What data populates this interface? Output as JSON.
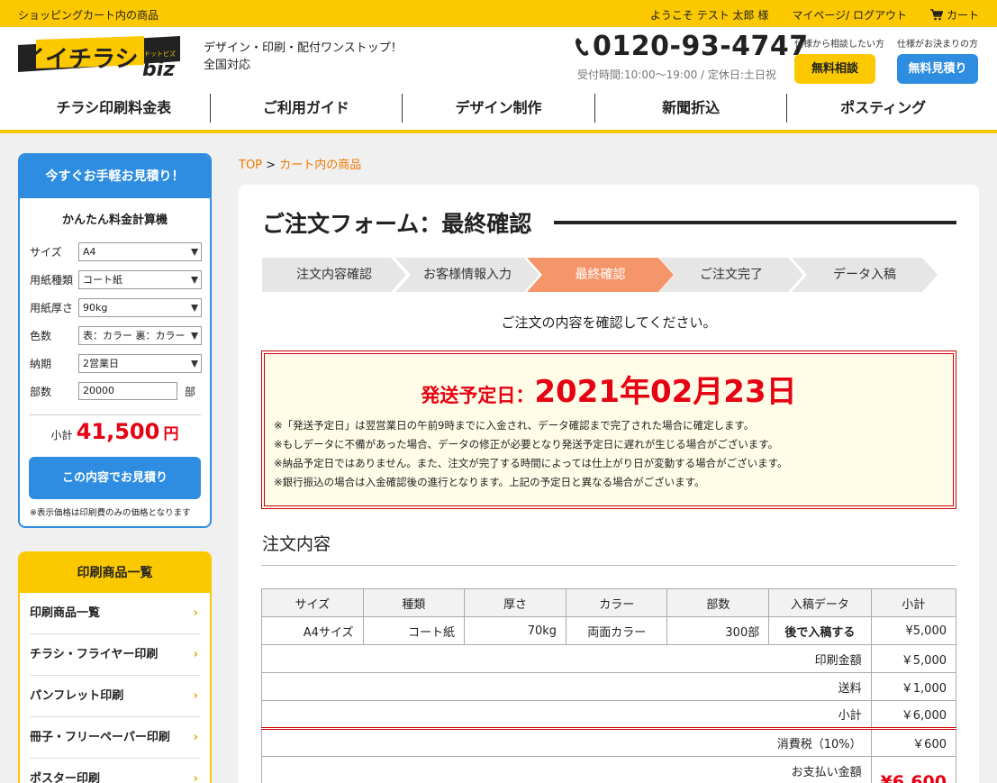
{
  "topbar": {
    "title": "ショッピングカート内の商品",
    "welcome": "ようこそ テスト 太郎 様",
    "mypage": "マイページ/ ログアウト",
    "cart": "カート"
  },
  "header": {
    "logo_text": "イイチラシ",
    "logo_sub": "biz",
    "logo_ruby": "ドットビズ",
    "tagline1": "デザイン・印刷・配付ワンストップ！",
    "tagline2": "全国対応",
    "phone": "0120-93-4747",
    "hours": "受付時間:10:00〜19:00 / 定休日:土日祝",
    "cta1_caption": "仕様から相談したい方",
    "cta1_label": "無料相談",
    "cta2_caption": "仕様がお決まりの方",
    "cta2_label": "無料見積り"
  },
  "nav": [
    "チラシ印刷料金表",
    "ご利用ガイド",
    "デザイン制作",
    "新聞折込",
    "ポスティング"
  ],
  "calculator": {
    "header": "今すぐお手軽お見積り！",
    "subtitle": "かんたん料金計算機",
    "fields": [
      {
        "label": "サイズ",
        "value": "A4"
      },
      {
        "label": "用紙種類",
        "value": "コート紙"
      },
      {
        "label": "用紙厚さ",
        "value": "90kg"
      },
      {
        "label": "色数",
        "value": "表：カラー 裏：カラー"
      },
      {
        "label": "納期",
        "value": "2営業日"
      }
    ],
    "qty_label": "部数",
    "qty_value": "20000",
    "qty_unit": "部",
    "subtotal_label": "小計",
    "subtotal_value": "41,500",
    "subtotal_unit": "円",
    "button": "この内容でお見積り",
    "note": "※表示価格は印刷費のみの価格となります"
  },
  "products": {
    "header": "印刷商品一覧",
    "items": [
      "印刷商品一覧",
      "チラシ・フライヤー印刷",
      "パンフレット印刷",
      "冊子・フリーペーパー印刷",
      "ポスター印刷"
    ]
  },
  "breadcrumb": {
    "top": "TOP",
    "sep": ">",
    "current": "カート内の商品"
  },
  "page": {
    "title": "ご注文フォーム：最終確認",
    "steps": [
      "注文内容確認",
      "お客様情報入力",
      "最終確認",
      "ご注文完了",
      "データ入稿"
    ],
    "active_step": 2,
    "lead": "ご注文の内容を確認してください。",
    "ship_label": "発送予定日：",
    "ship_date": "2021年02月23日",
    "ship_notes": [
      "※「発送予定日」は翌営業日の午前9時までに入金され、データ確認まで完了された場合に確定します。",
      "※もしデータに不備があった場合、データの修正が必要となり発送予定日に遅れが生じる場合がございます。",
      "※納品予定日ではありません。また、注文が完了する時間によっては仕上がり日が変動する場合がございます。",
      "※銀行振込の場合は入金確認後の進行となります。上記の予定日と異なる場合がございます。"
    ],
    "section": "注文内容"
  },
  "order": {
    "headers": [
      "サイズ",
      "種類",
      "厚さ",
      "カラー",
      "部数",
      "入稿データ",
      "小計"
    ],
    "row": [
      "A4サイズ",
      "コート紙",
      "70kg",
      "両面カラー",
      "300部",
      "後で入稿する",
      "¥5,000"
    ],
    "print_label": "印刷金額",
    "print_value": "￥5,000",
    "ship_label": "送料",
    "ship_value": "￥1,000",
    "sub_label": "小計",
    "sub_value": "￥6,000",
    "tax_label": "消費税（10%）",
    "tax_value": "￥600",
    "pay_label": "お支払い金額",
    "pay_value": "¥6,600"
  },
  "colors": {
    "yellow": "#fcc800",
    "blue": "#2e8de0",
    "red": "#e60012",
    "step_active": "#f5956a"
  }
}
